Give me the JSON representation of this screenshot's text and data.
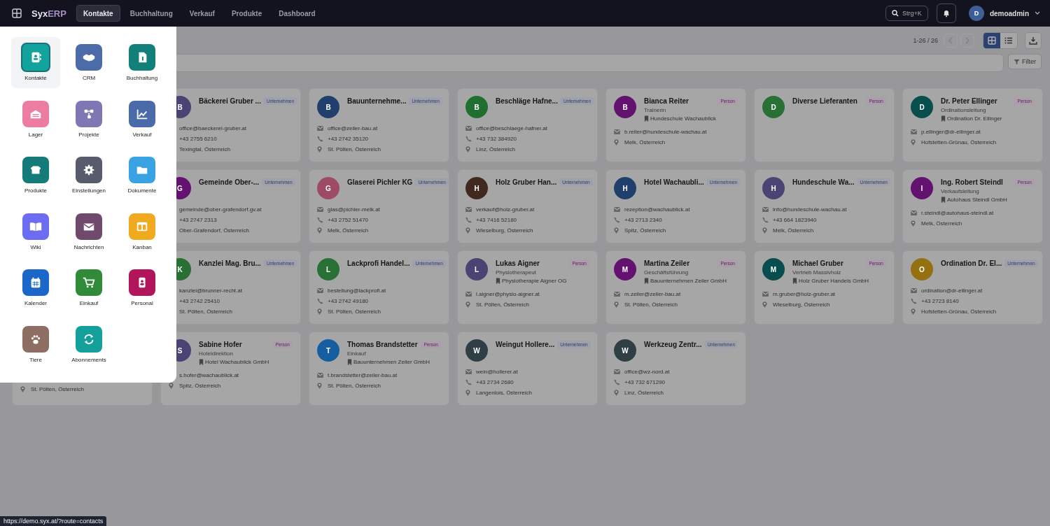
{
  "nav": {
    "logo_main": "Syx",
    "logo_accent": "ERP",
    "tabs": [
      {
        "label": "Kontakte",
        "selected": true
      },
      {
        "label": "Buchhaltung",
        "selected": false
      },
      {
        "label": "Verkauf",
        "selected": false
      },
      {
        "label": "Produkte",
        "selected": false
      },
      {
        "label": "Dashboard",
        "selected": false
      }
    ],
    "search_shortcut": "Strg+K",
    "user_initial": "D",
    "user_name": "demoadmin"
  },
  "toolbar": {
    "range": "1-26 / 26",
    "prev_disabled": true,
    "next_disabled": true,
    "views": [
      {
        "kind": "grid",
        "selected": true
      },
      {
        "kind": "list",
        "selected": false
      }
    ],
    "filter": "Filter"
  },
  "app_menu": [
    {
      "label": "Kontakte",
      "color": "#12a39c",
      "selected": true
    },
    {
      "label": "CRM",
      "color": "#4b6ca8",
      "selected": false
    },
    {
      "label": "Buchhaltung",
      "color": "#11807b",
      "selected": false
    },
    {
      "label": "Lager",
      "color": "#ec7ca2",
      "selected": false
    },
    {
      "label": "Projekte",
      "color": "#7e77b3",
      "selected": false
    },
    {
      "label": "Verkauf",
      "color": "#4a6aa9",
      "selected": false
    },
    {
      "label": "Produkte",
      "color": "#147b79",
      "selected": false
    },
    {
      "label": "Einstellungen",
      "color": "#585b6c",
      "selected": false
    },
    {
      "label": "Dokumente",
      "color": "#38a2e2",
      "selected": false
    },
    {
      "label": "Wiki",
      "color": "#6b6cf1",
      "selected": false
    },
    {
      "label": "Nachrichten",
      "color": "#6f4a6d",
      "selected": false
    },
    {
      "label": "Kanban",
      "color": "#efaa20",
      "selected": false
    },
    {
      "label": "Kalender",
      "color": "#1b67c9",
      "selected": false
    },
    {
      "label": "Einkauf",
      "color": "#2f8b37",
      "selected": false
    },
    {
      "label": "Personal",
      "color": "#b1155b",
      "selected": false
    },
    {
      "label": "Tiere",
      "color": "#8e6e63",
      "selected": false
    },
    {
      "label": "Abonnements",
      "color": "#13a09b",
      "selected": false
    }
  ],
  "rows": [
    [
      {
        "initial": "B",
        "color": "#4b4374",
        "name": "Bäckerei Gruber ...",
        "badge": "Unternehmen",
        "kind": "company",
        "email": "office@baeckerei-gruber.at",
        "phone": "+43 2755 6210",
        "location": "Texingtal, Österreich"
      },
      {
        "initial": "B",
        "color": "#213f6c",
        "name": "Bauunternehme...",
        "badge": "Unternehmen",
        "kind": "company",
        "email": "office@zeiler-bau.at",
        "phone": "+43 2742 35120",
        "location": "St. Pölten, Österreich"
      },
      {
        "initial": "B",
        "color": "#206f30",
        "name": "Beschläge Hafne...",
        "badge": "Unternehmen",
        "kind": "company",
        "email": "office@beschlaege-hafner.at",
        "phone": "+43 732 384920",
        "location": "Linz, Österreich"
      },
      {
        "initial": "B",
        "color": "#631270",
        "name": "Bianca Reiter",
        "badge": "Person",
        "kind": "person",
        "role": "Trainerin",
        "company": "Hundeschule Wachaublick",
        "email": "b.reiter@hundeschule-wachau.at",
        "location": "Melk, Österreich"
      },
      {
        "initial": "D",
        "color": "#297034",
        "name": "Diverse Lieferanten",
        "badge": "Person",
        "kind": "person"
      },
      {
        "initial": "D",
        "color": "#084e4e",
        "name": "Dr. Peter Ellinger",
        "badge": "Person",
        "kind": "person",
        "role": "Ordinationsleitung",
        "company": "Ordination Dr. Ellinger",
        "email": "p.ellinger@dr-ellinger.at",
        "location": "Hofstetten-Grünau, Österreich"
      }
    ],
    [
      {
        "initial": "G",
        "color": "#631270",
        "name": "Gemeinde Ober-...",
        "badge": "Unternehmen",
        "kind": "company",
        "email": "gemeinde@ober-grafendorf.gv.at",
        "phone": "+43 2747 2313",
        "location": "Ober-Grafendorf, Österreich"
      },
      {
        "initial": "G",
        "color": "#9d4a65",
        "name": "Glaserei Pichler KG",
        "badge": "Unternehmen",
        "kind": "company",
        "email": "glas@pichler-melk.at",
        "phone": "+43 2752 51470",
        "location": "Melk, Österreich"
      },
      {
        "initial": "H",
        "color": "#412920",
        "name": "Holz Gruber Han...",
        "badge": "Unternehmen",
        "kind": "company",
        "email": "verkauf@holz-gruber.at",
        "phone": "+43 7416 52180",
        "location": "Wieselburg, Österreich"
      },
      {
        "initial": "H",
        "color": "#213f6c",
        "name": "Hotel Wachaubli...",
        "badge": "Unternehmen",
        "kind": "company",
        "email": "rezeption@wachaublick.at",
        "phone": "+43 2713 2340",
        "location": "Spitz, Österreich"
      },
      {
        "initial": "H",
        "color": "#4b4374",
        "name": "Hundeschule Wa...",
        "badge": "Unternehmen",
        "kind": "company",
        "email": "info@hundeschule-wachau.at",
        "phone": "+43 664 1823940",
        "location": "Melk, Österreich"
      },
      {
        "initial": "I",
        "color": "#631270",
        "name": "Ing. Robert Steindl",
        "badge": "Person",
        "kind": "person",
        "role": "Verkaufsleitung",
        "company": "Autohaus Steindl GmbH",
        "email": "r.steindl@autohaus-steindl.at",
        "location": "Melk, Österreich"
      }
    ],
    [
      {
        "initial": "K",
        "color": "#297034",
        "name": "Kanzlei Mag. Bru...",
        "badge": "Unternehmen",
        "kind": "company",
        "email": "kanzlei@brunner-recht.at",
        "phone": "+43 2742 25410",
        "location": "St. Pölten, Österreich"
      },
      {
        "initial": "L",
        "color": "#297034",
        "name": "Lackprofi Handel...",
        "badge": "Unternehmen",
        "kind": "company",
        "email": "bestellung@lackprofi.at",
        "phone": "+43 2742 49180",
        "location": "St. Pölten, Österreich"
      },
      {
        "initial": "L",
        "color": "#4b4374",
        "name": "Lukas Aigner",
        "badge": "Person",
        "kind": "person",
        "role": "Physiotherapeut",
        "company": "Physiotherapie Aigner OG",
        "email": "l.aigner@physio-aigner.at",
        "location": "St. Pölten, Österreich"
      },
      {
        "initial": "M",
        "color": "#631270",
        "name": "Martina Zeiler",
        "badge": "Person",
        "kind": "person",
        "role": "Geschäftsführung",
        "company": "Bauunternehmen Zeiler GmbH",
        "email": "m.zeiler@zeiler-bau.at",
        "location": "St. Pölten, Österreich"
      },
      {
        "initial": "M",
        "color": "#084e4e",
        "name": "Michael Gruber",
        "badge": "Person",
        "kind": "person",
        "role": "Vertrieb Massivholz",
        "company": "Holz Gruber Handels GmbH",
        "email": "m.gruber@holz-gruber.at",
        "location": "Wieselburg, Österreich"
      },
      {
        "initial": "O",
        "color": "#947010",
        "name": "Ordination Dr. El...",
        "badge": "Unternehmen",
        "kind": "company",
        "email": "ordination@dr-ellinger.at",
        "phone": "+43 2723 8140",
        "location": "Hofstetten-Grünau, Österreich"
      }
    ],
    [
      {
        "location": "St. Pölten, Österreich"
      },
      {
        "initial": "S",
        "color": "#4b4374",
        "name": "Sabine Hofer",
        "badge": "Person",
        "kind": "person",
        "role": "Hoteldirektion",
        "company": "Hotel Wachaublick GmbH",
        "email": "s.hofer@wachaublick.at",
        "location": "Spitz, Österreich"
      },
      {
        "initial": "T",
        "color": "#155fa0",
        "name": "Thomas Brandstetter",
        "badge": "Person",
        "kind": "person",
        "role": "Einkauf",
        "company": "Bauunternehmen Zeiler GmbH",
        "email": "t.brandstetter@zeiler-bau.at",
        "location": "St. Pölten, Österreich"
      },
      {
        "initial": "W",
        "color": "#303f46",
        "name": "Weingut Hollere...",
        "badge": "Unternehmen",
        "kind": "company",
        "email": "wein@hollerer.at",
        "phone": "+43 2734 2680",
        "location": "Langenlois, Österreich"
      },
      {
        "initial": "W",
        "color": "#303f46",
        "name": "Werkzeug Zentr...",
        "badge": "Unternehmen",
        "kind": "company",
        "email": "office@wz-nord.at",
        "phone": "+43 732 671290",
        "location": "Linz, Österreich"
      }
    ]
  ],
  "status_url": "https://demo.syx.at/?route=contacts"
}
